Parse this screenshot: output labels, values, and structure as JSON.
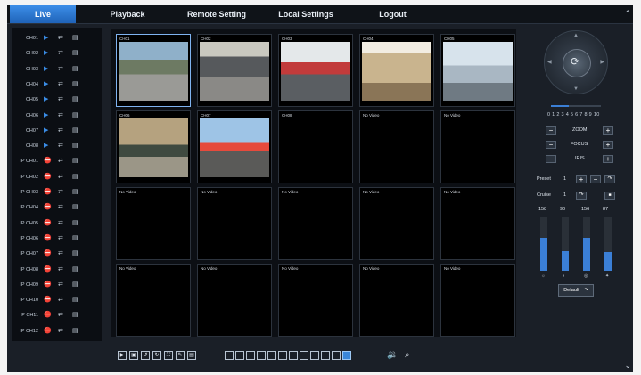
{
  "nav": {
    "tabs": [
      {
        "label": "Live",
        "active": true
      },
      {
        "label": "Playback"
      },
      {
        "label": "Remote Setting"
      },
      {
        "label": "Local Settings"
      },
      {
        "label": "Logout"
      }
    ]
  },
  "channels": [
    "CH01",
    "CH02",
    "CH03",
    "CH04",
    "CH05",
    "CH06",
    "CH07",
    "CH08",
    "IP CH01",
    "IP CH02",
    "IP CH03",
    "IP CH04",
    "IP CH05",
    "IP CH06",
    "IP CH07",
    "IP CH08",
    "IP CH09",
    "IP CH10",
    "IP CH11",
    "IP CH12"
  ],
  "cells": [
    {
      "label": "CH01",
      "video": true
    },
    {
      "label": "CH02",
      "video": true
    },
    {
      "label": "CH03",
      "video": true
    },
    {
      "label": "CH04",
      "video": true
    },
    {
      "label": "CH05",
      "video": true
    },
    {
      "label": "CH06",
      "video": true
    },
    {
      "label": "CH07",
      "video": true
    },
    {
      "label": "CH08",
      "video": false
    },
    {
      "label": "No Video",
      "video": false
    },
    {
      "label": "No Video",
      "video": false
    },
    {
      "label": "No Video",
      "video": false
    },
    {
      "label": "No Video",
      "video": false
    },
    {
      "label": "No Video",
      "video": false
    },
    {
      "label": "No Video",
      "video": false
    },
    {
      "label": "No Video",
      "video": false
    },
    {
      "label": "No Video",
      "video": false
    },
    {
      "label": "No Video",
      "video": false
    },
    {
      "label": "No Video",
      "video": false
    },
    {
      "label": "No Video",
      "video": false
    },
    {
      "label": "No Video",
      "video": false
    }
  ],
  "ptz": {
    "speed_numbers": "0 1 2 3 4 5 6 7 8 9 10",
    "speed_level": 0.35,
    "zoom_label": "ZOOM",
    "focus_label": "FOCUS",
    "iris_label": "IRIS",
    "preset_label": "Preset",
    "preset_value": "1",
    "cruise_label": "Cruise",
    "cruise_value": "1",
    "default_label": "Default",
    "image_values": [
      {
        "value": "158",
        "level": 0.62,
        "icon": "brightness-icon"
      },
      {
        "value": "90",
        "level": 0.36,
        "icon": "contrast-icon"
      },
      {
        "value": "156",
        "level": 0.61,
        "icon": "saturation-icon"
      },
      {
        "value": "87",
        "level": 0.35,
        "icon": "hue-icon"
      }
    ]
  },
  "colors": {
    "accent": "#3b7fd6",
    "background": "#1a1f27"
  }
}
